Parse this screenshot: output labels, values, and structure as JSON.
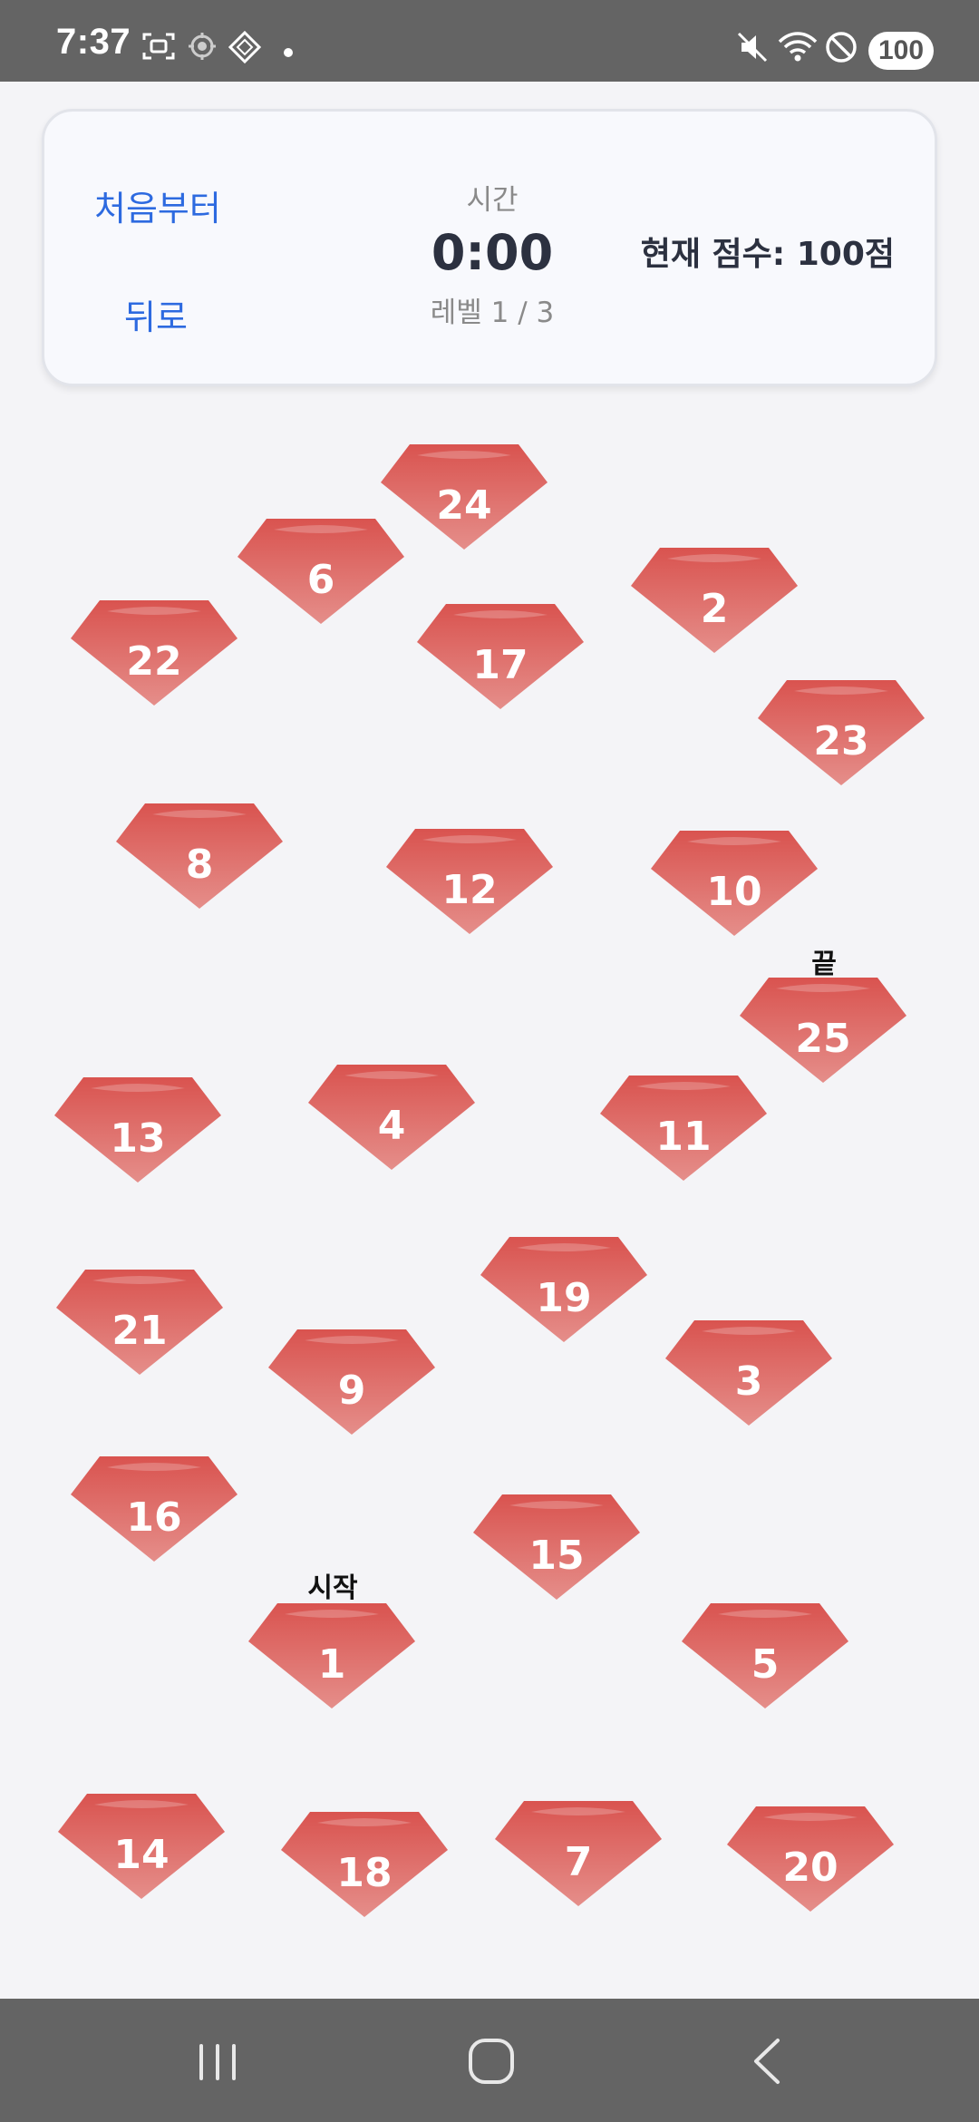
{
  "status_bar": {
    "time": "7:37",
    "battery": "100",
    "icons": [
      "screenshot-icon",
      "location-icon",
      "app-icon",
      "dot-icon",
      "mute-icon",
      "wifi-icon",
      "dnd-icon"
    ]
  },
  "header": {
    "restart_label": "처음부터",
    "back_label": "뒤로",
    "time_caption": "시간",
    "timer": "0:00",
    "level": "레벨 1 / 3",
    "score": "현재 점수: 100점"
  },
  "board": {
    "start_label": "시작",
    "end_label": "끝",
    "gem_color": "#d9534f",
    "gems": [
      "24",
      "6",
      "2",
      "22",
      "17",
      "23",
      "8",
      "12",
      "10",
      "25",
      "13",
      "4",
      "11",
      "19",
      "21",
      "9",
      "3",
      "16",
      "15",
      "1",
      "5",
      "14",
      "18",
      "7",
      "20"
    ]
  },
  "nav": {
    "icons": [
      "recents-icon",
      "home-icon",
      "back-icon"
    ]
  }
}
